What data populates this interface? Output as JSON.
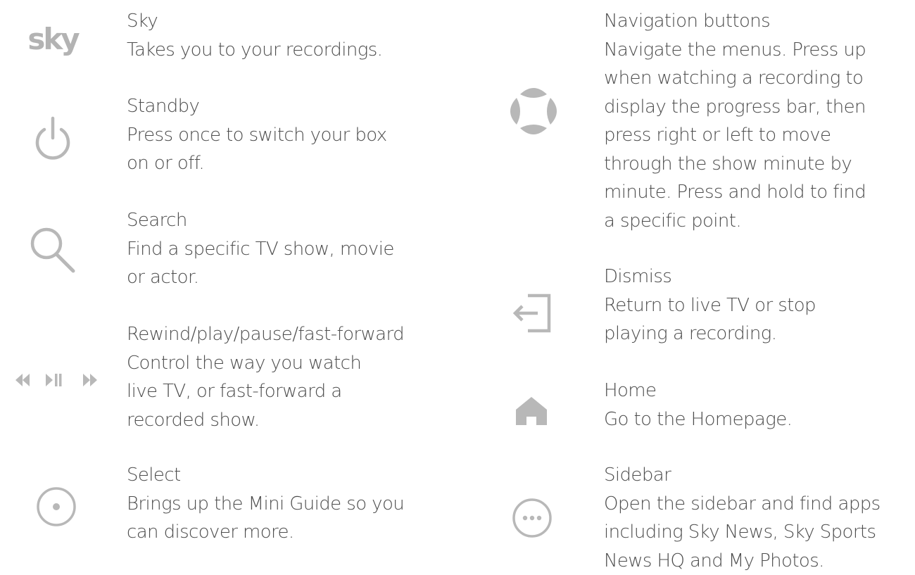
{
  "colors": {
    "icon": "#b8b8b8",
    "text": "#4d4d4d",
    "background": "#ffffff"
  },
  "left": [
    {
      "key": "sky",
      "icon": "sky-logo",
      "logo_text": "sky",
      "title": "Sky",
      "desc": "Takes you to your recordings."
    },
    {
      "key": "standby",
      "icon": "power-icon",
      "title": "Standby",
      "desc": "Press once to switch your box\non or off."
    },
    {
      "key": "search",
      "icon": "search-icon",
      "title": "Search",
      "desc": "Find a specific TV show, movie\nor actor."
    },
    {
      "key": "transport",
      "icon": "rewind-play-pause-fast-forward-icon",
      "title": "Rewind/play/pause/fast-forward",
      "desc": "Control the way you watch\nlive TV, or fast-forward a\nrecorded show."
    },
    {
      "key": "select",
      "icon": "select-icon",
      "title": "Select",
      "desc": "Brings up the Mini Guide so you\ncan discover more."
    }
  ],
  "right": [
    {
      "key": "navigation",
      "icon": "navigation-pad-icon",
      "title": "Navigation buttons",
      "desc": "Navigate the menus. Press up\nwhen watching a recording to\ndisplay the progress bar, then\npress right or left to move\nthrough the show minute by\nminute. Press and hold to find\na specific point."
    },
    {
      "key": "dismiss",
      "icon": "dismiss-icon",
      "title": "Dismiss",
      "desc": "Return to live TV or stop\nplaying a recording."
    },
    {
      "key": "home",
      "icon": "home-icon",
      "title": "Home",
      "desc": "Go to the Homepage."
    },
    {
      "key": "sidebar",
      "icon": "sidebar-icon",
      "title": "Sidebar",
      "desc": "Open the sidebar and find apps\nincluding Sky News, Sky Sports\nNews HQ and My Photos."
    }
  ]
}
